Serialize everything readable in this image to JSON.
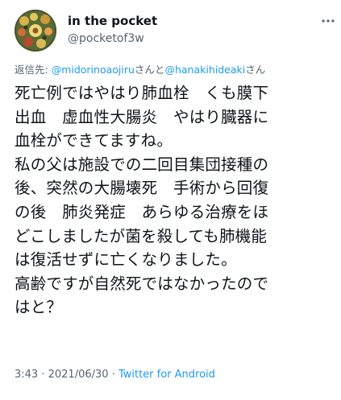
{
  "tweet": {
    "display_name": "in the pocket",
    "handle": "@pocketof3w",
    "reply_prefix": "返信先: ",
    "reply_user_1": "@midorinoaojiru",
    "reply_joiner": "さんと",
    "reply_user_2": "@hanakihideaki",
    "reply_suffix": "さん",
    "body_lines": [
      "死亡例ではやはり肺血栓　くも膜下",
      "出血　虚血性大腸炎　やはり臓器に",
      "血栓ができてますね。",
      "私の父は施設での二回目集団接種の",
      "後、突然の大腸壊死　手術から回復",
      "の後　肺炎発症　あらゆる治療をほ",
      "どこしましたが菌を殺しても肺機能",
      "は復活せずに亡くなりました。",
      "高齢ですが自然死ではなかったので",
      "はと？"
    ],
    "time": "3:43",
    "separator_1": " · ",
    "date": "2021/06/30",
    "separator_2": " · ",
    "source": "Twitter for Android"
  },
  "icons": {
    "avatar": "profile-avatar-image",
    "more": "more-options-icon"
  },
  "colors": {
    "text": "#0f1419",
    "secondary": "#536471",
    "link": "#1d9bf0"
  }
}
